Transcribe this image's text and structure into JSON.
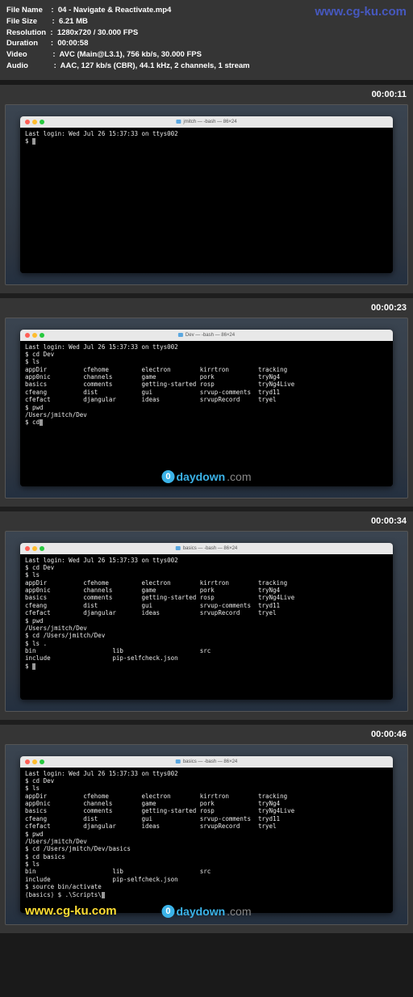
{
  "watermark_top": "www.cg-ku.com",
  "meta": {
    "file_name_label": "File Name    :  ",
    "file_name": "04 - Navigate & Reactivate.mp4",
    "file_size_label": "File Size       :  ",
    "file_size": "6.21 MB",
    "resolution_label": "Resolution  :  ",
    "resolution": "1280x720 / 30.000 FPS",
    "duration_label": "Duration      :  ",
    "duration": "00:00:58",
    "video_label": "Video            :  ",
    "video": "AVC (Main@L3.1), 756 kb/s, 30.000 FPS",
    "audio_label": "Audio            :  ",
    "audio": "AAC, 127 kb/s (CBR), 44.1 kHz, 2 channels, 1 stream"
  },
  "frames": [
    {
      "timestamp": "00:00:11",
      "title": "jmitch — -bash — 86×24",
      "term": "Last login: Wed Jul 26 15:37:33 on ttys002\n$ "
    },
    {
      "timestamp": "00:00:23",
      "title": "Dev — -bash — 86×24",
      "term": "Last login: Wed Jul 26 15:37:33 on ttys002\n$ cd Dev\n$ ls\nappDir          cfehome         electron        kirrtron        tracking\napp0nic         channels        game            pork            tryNg4\nbasics          comments        getting-started rosp            tryNg4Live\ncfeang          dist            gui             srvup-comments  tryd11\ncfefact         djangular       ideas           srvupRecord     tryel\n$ pwd\n/Users/jmitch/Dev\n$ cd",
      "badge": true
    },
    {
      "timestamp": "00:00:34",
      "title": "basics — -bash — 86×24",
      "term": "Last login: Wed Jul 26 15:37:33 on ttys002\n$ cd Dev\n$ ls\nappDir          cfehome         electron        kirrtron        tracking\napp0nic         channels        game            pork            tryNg4\nbasics          comments        getting-started rosp            tryNg4Live\ncfeang          dist            gui             srvup-comments  tryd11\ncfefact         djangular       ideas           srvupRecord     tryel\n$ pwd\n/Users/jmitch/Dev\n$ cd /Users/jmitch/Dev\n$ ls .\nbin                     lib                     src\ninclude                 pip-selfcheck.json\n$ "
    },
    {
      "timestamp": "00:00:46",
      "title": "basics — -bash — 86×24",
      "term": "Last login: Wed Jul 26 15:37:33 on ttys002\n$ cd Dev\n$ ls\nappDir          cfehome         electron        kirrtron        tracking\napp0nic         channels        game            pork            tryNg4\nbasics          comments        getting-started rosp            tryNg4Live\ncfeang          dist            gui             srvup-comments  tryd11\ncfefact         djangular       ideas           srvupRecord     tryel\n$ pwd\n/Users/jmitch/Dev\n$ cd /Users/jmitch/Dev/basics\n$ cd basics\n$ ls\nbin                     lib                     src\ninclude                 pip-selfcheck.json\n$ source bin/activate\n(basics) $ .\\Scripts\\",
      "bottom_overlay": true
    }
  ],
  "cgku_bottom": "www.cg-ku.com",
  "daydown": {
    "zero": "0",
    "txt": "daydown",
    "com": ".com"
  }
}
